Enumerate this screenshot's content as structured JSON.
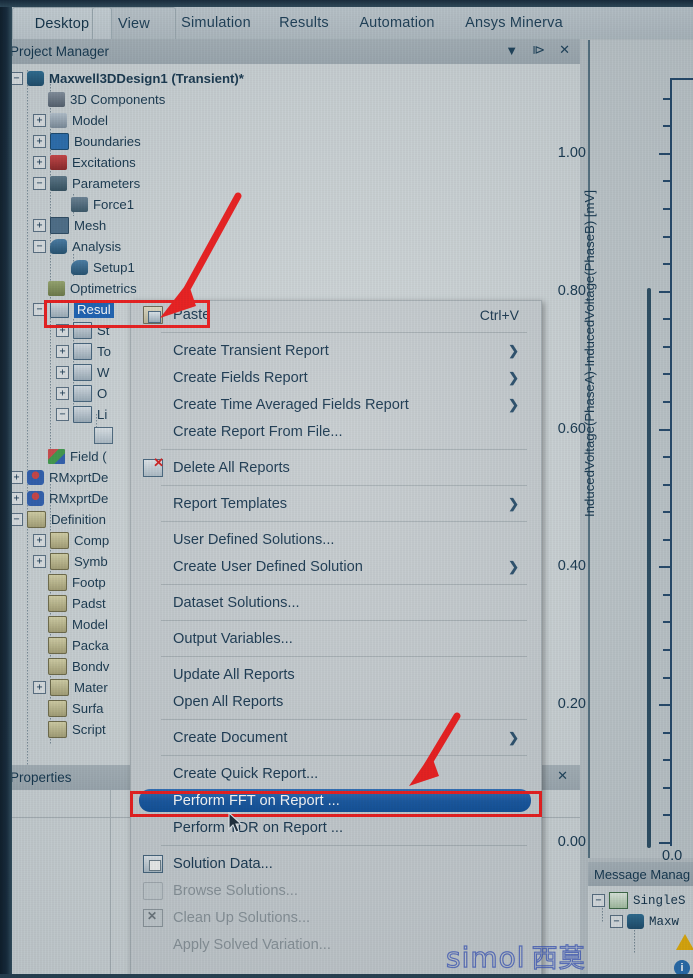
{
  "ribbon": {
    "tabs": [
      {
        "label": "Desktop",
        "active": true
      },
      {
        "label": "View",
        "active": false
      },
      {
        "label": "Simulation",
        "active": false
      },
      {
        "label": "Results",
        "active": false
      },
      {
        "label": "Automation",
        "active": false
      },
      {
        "label": "Ansys Minerva",
        "active": false
      }
    ]
  },
  "project_manager": {
    "title": "Project Manager",
    "controls": {
      "dropdown": "▼",
      "pin": "⧐",
      "close": "✕"
    },
    "tree": [
      {
        "label": "Maxwell3DDesign1 (Transient)*",
        "indent": 0,
        "expander": "-",
        "icon": "maxwell-design-icon",
        "bold": true
      },
      {
        "label": "3D Components",
        "indent": 1,
        "expander": "",
        "icon": "3d-components-icon",
        "bold": false
      },
      {
        "label": "Model",
        "indent": 1,
        "expander": "+",
        "icon": "model-icon",
        "bold": false
      },
      {
        "label": "Boundaries",
        "indent": 1,
        "expander": "+",
        "icon": "boundaries-icon",
        "bold": false
      },
      {
        "label": "Excitations",
        "indent": 1,
        "expander": "+",
        "icon": "excitations-icon",
        "bold": false
      },
      {
        "label": "Parameters",
        "indent": 1,
        "expander": "-",
        "icon": "parameters-icon",
        "bold": false
      },
      {
        "label": "Force1",
        "indent": 2,
        "expander": "",
        "icon": "force-icon",
        "bold": false
      },
      {
        "label": "Mesh",
        "indent": 1,
        "expander": "+",
        "icon": "mesh-icon",
        "bold": false
      },
      {
        "label": "Analysis",
        "indent": 1,
        "expander": "-",
        "icon": "analysis-icon",
        "bold": false
      },
      {
        "label": "Setup1",
        "indent": 2,
        "expander": "",
        "icon": "setup-icon",
        "bold": false
      },
      {
        "label": "Optimetrics",
        "indent": 1,
        "expander": "",
        "icon": "optimetrics-icon",
        "bold": false
      },
      {
        "label": "Resul",
        "indent": 1,
        "expander": "-",
        "icon": "results-icon",
        "bold": false,
        "selected": true
      },
      {
        "label": "St",
        "indent": 2,
        "expander": "+",
        "icon": "report-icon",
        "bold": false
      },
      {
        "label": "To",
        "indent": 2,
        "expander": "+",
        "icon": "report-icon",
        "bold": false
      },
      {
        "label": "W",
        "indent": 2,
        "expander": "+",
        "icon": "report-icon",
        "bold": false
      },
      {
        "label": "O",
        "indent": 2,
        "expander": "+",
        "icon": "report-icon",
        "bold": false
      },
      {
        "label": "Li",
        "indent": 2,
        "expander": "-",
        "icon": "report-icon",
        "bold": false
      },
      {
        "label": "",
        "indent": 3,
        "expander": "",
        "icon": "report-child-icon",
        "bold": false
      },
      {
        "label": "Field (",
        "indent": 1,
        "expander": "",
        "icon": "field-overlays-icon",
        "bold": false
      },
      {
        "label": "RMxprtDe",
        "indent": 0,
        "expander": "+",
        "icon": "rmxprt-icon",
        "bold": false
      },
      {
        "label": "RMxprtDe",
        "indent": 0,
        "expander": "+",
        "icon": "rmxprt-icon",
        "bold": false
      },
      {
        "label": "Definition",
        "indent": 0,
        "expander": "-",
        "icon": "folder-icon",
        "bold": false
      },
      {
        "label": "Comp",
        "indent": 1,
        "expander": "+",
        "icon": "folder-icon",
        "bold": false
      },
      {
        "label": "Symb",
        "indent": 1,
        "expander": "+",
        "icon": "folder-icon",
        "bold": false
      },
      {
        "label": "Footp",
        "indent": 1,
        "expander": "",
        "icon": "folder-icon",
        "bold": false
      },
      {
        "label": "Padst",
        "indent": 1,
        "expander": "",
        "icon": "folder-icon",
        "bold": false
      },
      {
        "label": "Model",
        "indent": 1,
        "expander": "",
        "icon": "folder-icon",
        "bold": false
      },
      {
        "label": "Packa",
        "indent": 1,
        "expander": "",
        "icon": "folder-icon",
        "bold": false
      },
      {
        "label": "Bondv",
        "indent": 1,
        "expander": "",
        "icon": "folder-icon",
        "bold": false
      },
      {
        "label": "Mater",
        "indent": 1,
        "expander": "+",
        "icon": "folder-icon",
        "bold": false
      },
      {
        "label": "Surfa",
        "indent": 1,
        "expander": "",
        "icon": "folder-icon",
        "bold": false
      },
      {
        "label": "Script",
        "indent": 1,
        "expander": "",
        "icon": "folder-icon",
        "bold": false
      }
    ]
  },
  "context_menu": {
    "items": [
      {
        "label": "Paste",
        "shortcut": "Ctrl+V",
        "icon": "paste-icon",
        "submenu": false,
        "disabled": false
      },
      {
        "separator": true
      },
      {
        "label": "Create Transient Report",
        "shortcut": "",
        "icon": "",
        "submenu": true,
        "disabled": false
      },
      {
        "label": "Create Fields Report",
        "shortcut": "",
        "icon": "",
        "submenu": true,
        "disabled": false
      },
      {
        "label": "Create Time Averaged Fields Report",
        "shortcut": "",
        "icon": "",
        "submenu": true,
        "disabled": false
      },
      {
        "label": "Create Report From File...",
        "shortcut": "",
        "icon": "",
        "submenu": false,
        "disabled": false
      },
      {
        "separator": true
      },
      {
        "label": "Delete All Reports",
        "shortcut": "",
        "icon": "delete-reports-icon",
        "submenu": false,
        "disabled": false
      },
      {
        "separator": true
      },
      {
        "label": "Report Templates",
        "shortcut": "",
        "icon": "",
        "submenu": true,
        "disabled": false
      },
      {
        "separator": true
      },
      {
        "label": "User Defined Solutions...",
        "shortcut": "",
        "icon": "",
        "submenu": false,
        "disabled": false
      },
      {
        "label": "Create User Defined Solution",
        "shortcut": "",
        "icon": "",
        "submenu": true,
        "disabled": false
      },
      {
        "separator": true
      },
      {
        "label": "Dataset Solutions...",
        "shortcut": "",
        "icon": "",
        "submenu": false,
        "disabled": false
      },
      {
        "separator": true
      },
      {
        "label": "Output Variables...",
        "shortcut": "",
        "icon": "",
        "submenu": false,
        "disabled": false
      },
      {
        "separator": true
      },
      {
        "label": "Update All Reports",
        "shortcut": "",
        "icon": "",
        "submenu": false,
        "disabled": false
      },
      {
        "label": "Open All Reports",
        "shortcut": "",
        "icon": "",
        "submenu": false,
        "disabled": false
      },
      {
        "separator": true
      },
      {
        "label": "Create Document",
        "shortcut": "",
        "icon": "",
        "submenu": true,
        "disabled": false
      },
      {
        "separator": true
      },
      {
        "label": "Create Quick Report...",
        "shortcut": "",
        "icon": "",
        "submenu": false,
        "disabled": false
      },
      {
        "label": "Perform FFT on Report ...",
        "shortcut": "",
        "icon": "",
        "submenu": false,
        "disabled": false,
        "highlighted": true
      },
      {
        "label": "Perform TDR on Report ...",
        "shortcut": "",
        "icon": "",
        "submenu": false,
        "disabled": false
      },
      {
        "separator": true
      },
      {
        "label": "Solution Data...",
        "shortcut": "",
        "icon": "solution-data-icon",
        "submenu": false,
        "disabled": false
      },
      {
        "label": "Browse Solutions...",
        "shortcut": "",
        "icon": "browse-solutions-icon",
        "submenu": false,
        "disabled": true
      },
      {
        "label": "Clean Up Solutions...",
        "shortcut": "",
        "icon": "clean-up-solutions-icon",
        "submenu": false,
        "disabled": true
      },
      {
        "label": "Apply Solved Variation...",
        "shortcut": "",
        "icon": "",
        "submenu": false,
        "disabled": true
      }
    ]
  },
  "properties": {
    "title": "Properties",
    "controls": {
      "pin": "⧐",
      "close": "✕"
    }
  },
  "message_manager": {
    "title": "Message Manag",
    "rows": [
      {
        "label": "SingleS",
        "indent": 0,
        "expander": "-",
        "icon": "project-icon"
      },
      {
        "label": "Maxw",
        "indent": 1,
        "expander": "-",
        "icon": "maxwell-design-icon"
      }
    ]
  },
  "chart_data": {
    "type": "line",
    "title": "",
    "xlabel": "",
    "ylabel": "InducedVoltage(PhaseA)-InducedVoltage(PhaseB) [mV]",
    "y_ticks": [
      "1.00",
      "0.80",
      "0.60",
      "0.40",
      "0.20",
      "0.00"
    ],
    "y_tick_values": [
      1.0,
      0.8,
      0.6,
      0.4,
      0.2,
      0.0
    ],
    "ylim": [
      0.0,
      1.1
    ],
    "x_ticks": [
      "0.0"
    ],
    "minor_ticks_per_major": 4,
    "grid": false,
    "legend": "",
    "series": [],
    "note": "Only the left y-axis of the plot is visible at the right edge of the screenshot; data curve is off-screen."
  },
  "annotations": {
    "watermark": "simol",
    "watermark_cn": "西莫",
    "highlight_color": "#f01a1a",
    "selection_color": "#1b62b5",
    "menu_highlight_color": "#0d4e98"
  }
}
